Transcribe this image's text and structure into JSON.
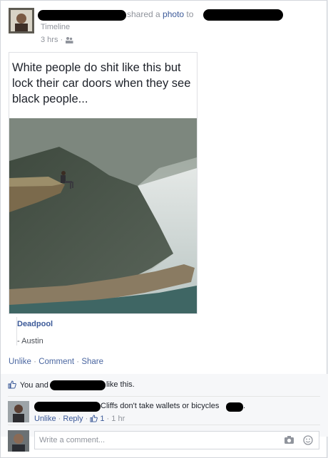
{
  "header": {
    "shared_text": "shared a photo to",
    "photo_link": "photo",
    "shared_prefix": "shared a",
    "to_text": "to",
    "sub_source": "Timeline",
    "timestamp": "3 hrs ·"
  },
  "meme": {
    "caption": "White people do shit like this but lock their car doors when they see black people..."
  },
  "attribution": {
    "source": "Deadpool",
    "author": "- Austin"
  },
  "actions": {
    "unlike": "Unlike",
    "sep1": "·",
    "comment": "Comment",
    "sep2": "·",
    "share": "Share"
  },
  "likes": {
    "prefix": "You and",
    "suffix": "like this."
  },
  "comment": {
    "text": "Cliffs don't take wallets or bicycles",
    "end": ".",
    "unlike": "Unlike",
    "reply": "Reply",
    "like_count": "1",
    "time": "1 hr"
  },
  "composer": {
    "placeholder": "Write a comment..."
  },
  "colors": {
    "link": "#3b5998",
    "meta": "#90949c",
    "water": "#d4dbd8"
  }
}
